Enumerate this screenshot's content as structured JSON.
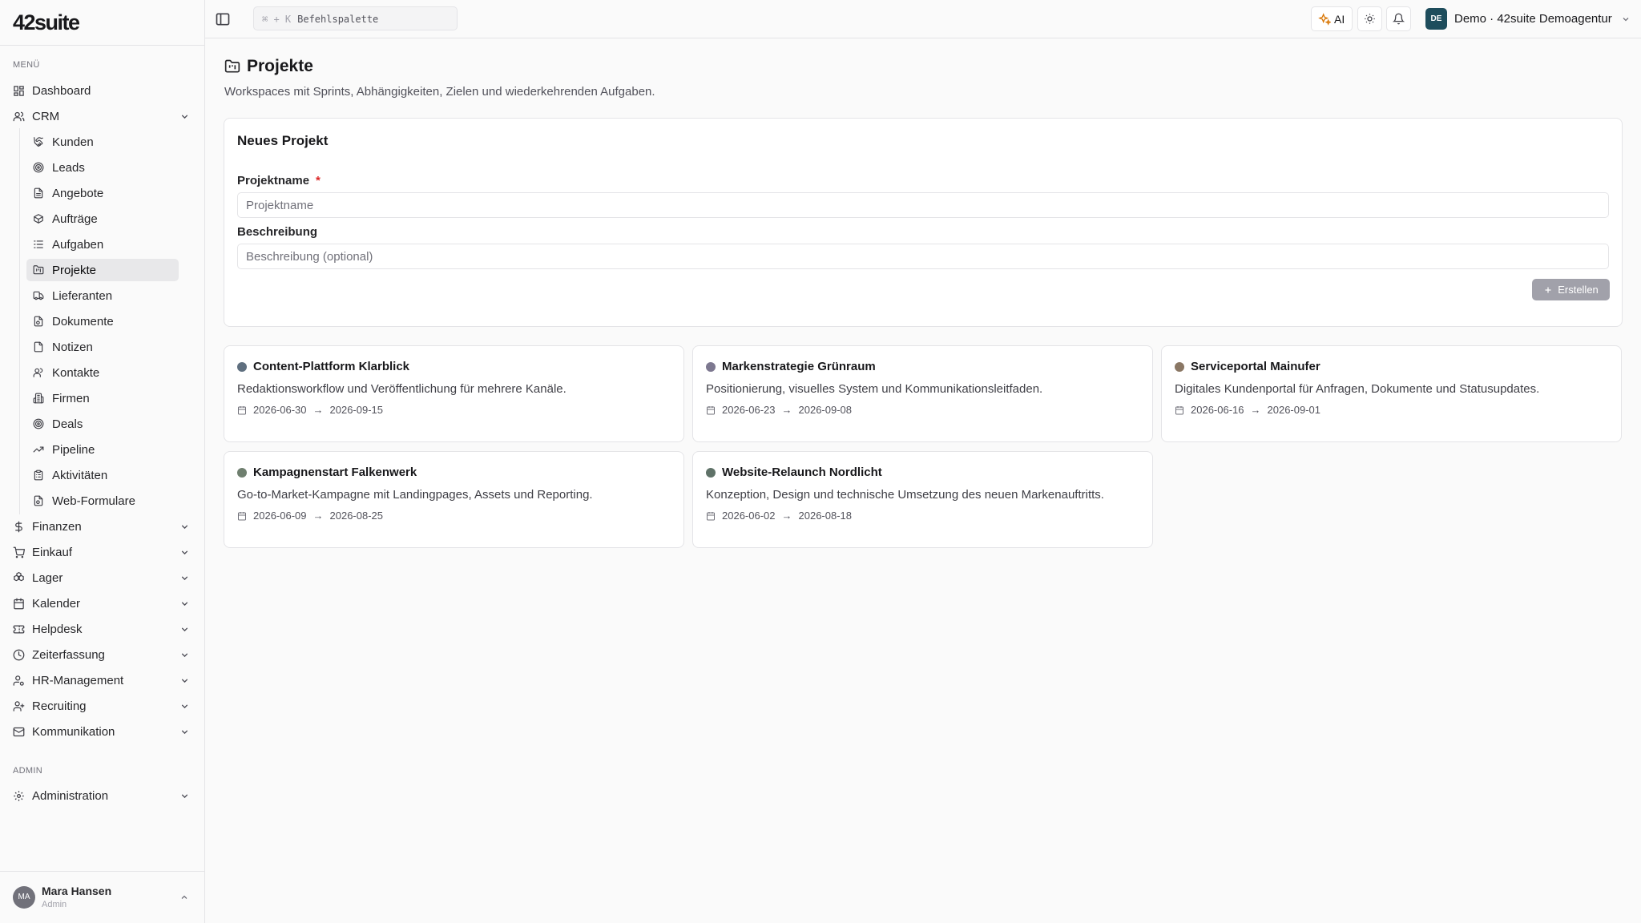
{
  "app": {
    "logo": "42suite"
  },
  "sidebar": {
    "menu_label": "MENÜ",
    "admin_label": "ADMIN",
    "dashboard": "Dashboard",
    "crm": "CRM",
    "crm_items": [
      "Kunden",
      "Leads",
      "Angebote",
      "Aufträge",
      "Aufgaben",
      "Projekte",
      "Lieferanten",
      "Dokumente",
      "Notizen",
      "Kontakte",
      "Firmen",
      "Deals",
      "Pipeline",
      "Aktivitäten",
      "Web-Formulare"
    ],
    "groups": [
      "Finanzen",
      "Einkauf",
      "Lager",
      "Kalender",
      "Helpdesk",
      "Zeiterfassung",
      "HR-Management",
      "Recruiting",
      "Kommunikation"
    ],
    "administration": "Administration",
    "active_item": "Projekte"
  },
  "user": {
    "initials": "MA",
    "name": "Mara Hansen",
    "role": "Admin"
  },
  "topbar": {
    "command_shortcut": "⌘ + K",
    "command_label": "Befehlspalette",
    "ai_label": "AI",
    "workspace_badge": "DE",
    "workspace_label": "Demo · 42suite Demoagentur"
  },
  "page": {
    "title": "Projekte",
    "subtitle": "Workspaces mit Sprints, Abhängigkeiten, Zielen und wiederkehrenden Aufgaben."
  },
  "form": {
    "title": "Neues Projekt",
    "name_label": "Projektname",
    "required_mark": "*",
    "name_placeholder": "Projektname",
    "desc_label": "Beschreibung",
    "desc_placeholder": "Beschreibung (optional)",
    "create_label": "Erstellen"
  },
  "projects": [
    {
      "name": "Content-Plattform Klarblick",
      "description": "Redaktionsworkflow und Veröffentlichung für mehrere Kanäle.",
      "start": "2026-06-30",
      "end": "2026-09-15",
      "color": "#5f6f7f"
    },
    {
      "name": "Markenstrategie Grünraum",
      "description": "Positionierung, visuelles System und Kommunikationsleitfaden.",
      "start": "2026-06-23",
      "end": "2026-09-08",
      "color": "#7d7890"
    },
    {
      "name": "Serviceportal Mainufer",
      "description": "Digitales Kundenportal für Anfragen, Dokumente und Statusupdates.",
      "start": "2026-06-16",
      "end": "2026-09-01",
      "color": "#8a7764"
    },
    {
      "name": "Kampagnenstart Falkenwerk",
      "description": "Go-to-Market-Kampagne mit Landingpages, Assets und Reporting.",
      "start": "2026-06-09",
      "end": "2026-08-25",
      "color": "#6f7f6f"
    },
    {
      "name": "Website-Relaunch Nordlicht",
      "description": "Konzeption, Design und technische Umsetzung des neuen Markenauftritts.",
      "start": "2026-06-02",
      "end": "2026-08-18",
      "color": "#5f7268"
    }
  ],
  "date_arrow": "→"
}
